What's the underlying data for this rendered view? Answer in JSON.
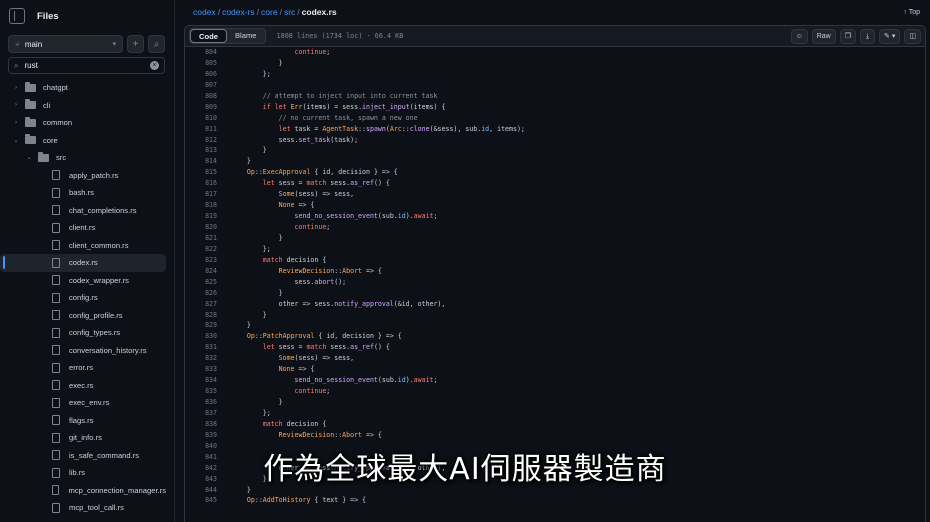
{
  "sidebar": {
    "title": "Files",
    "branch": "main",
    "search_value": "rust",
    "tree": [
      {
        "label": "chatgpt",
        "kind": "folder",
        "depth": 0,
        "open": false
      },
      {
        "label": "cli",
        "kind": "folder",
        "depth": 0,
        "open": false
      },
      {
        "label": "common",
        "kind": "folder",
        "depth": 0,
        "open": false
      },
      {
        "label": "core",
        "kind": "folder",
        "depth": 0,
        "open": true
      },
      {
        "label": "src",
        "kind": "folder",
        "depth": 1,
        "open": true
      },
      {
        "label": "apply_patch.rs",
        "kind": "file",
        "depth": 2
      },
      {
        "label": "bash.rs",
        "kind": "file",
        "depth": 2
      },
      {
        "label": "chat_completions.rs",
        "kind": "file",
        "depth": 2
      },
      {
        "label": "client.rs",
        "kind": "file",
        "depth": 2
      },
      {
        "label": "client_common.rs",
        "kind": "file",
        "depth": 2
      },
      {
        "label": "codex.rs",
        "kind": "file",
        "depth": 2,
        "active": true
      },
      {
        "label": "codex_wrapper.rs",
        "kind": "file",
        "depth": 2
      },
      {
        "label": "config.rs",
        "kind": "file",
        "depth": 2
      },
      {
        "label": "config_profile.rs",
        "kind": "file",
        "depth": 2
      },
      {
        "label": "config_types.rs",
        "kind": "file",
        "depth": 2
      },
      {
        "label": "conversation_history.rs",
        "kind": "file",
        "depth": 2
      },
      {
        "label": "error.rs",
        "kind": "file",
        "depth": 2
      },
      {
        "label": "exec.rs",
        "kind": "file",
        "depth": 2
      },
      {
        "label": "exec_env.rs",
        "kind": "file",
        "depth": 2
      },
      {
        "label": "flags.rs",
        "kind": "file",
        "depth": 2
      },
      {
        "label": "git_info.rs",
        "kind": "file",
        "depth": 2
      },
      {
        "label": "is_safe_command.rs",
        "kind": "file",
        "depth": 2
      },
      {
        "label": "lib.rs",
        "kind": "file",
        "depth": 2
      },
      {
        "label": "mcp_connection_manager.rs",
        "kind": "file",
        "depth": 2
      },
      {
        "label": "mcp_tool_call.rs",
        "kind": "file",
        "depth": 2
      }
    ]
  },
  "breadcrumb": {
    "parts": [
      "codex",
      "codex-rs",
      "core",
      "src"
    ],
    "current": "codex.rs",
    "top_label": "Top"
  },
  "toolbar": {
    "code_label": "Code",
    "blame_label": "Blame",
    "meta": "1808 lines (1734 loc) · 66.4 KB",
    "raw_label": "Raw"
  },
  "code": {
    "lines": [
      {
        "n": "804",
        "html": "                <span class='kw'>continue</span>;"
      },
      {
        "n": "805",
        "html": "            }"
      },
      {
        "n": "806",
        "html": "        };"
      },
      {
        "n": "807",
        "html": ""
      },
      {
        "n": "808",
        "html": "        <span class='cm'>// attempt to inject input into current task</span>"
      },
      {
        "n": "809",
        "html": "        <span class='kw'>if let</span> <span class='ty'>Err</span>(items) = sess.<span class='fn'>inject_input</span>(items) {"
      },
      {
        "n": "810",
        "html": "            <span class='cm'>// no current task, spawn a new one</span>"
      },
      {
        "n": "811",
        "html": "            <span class='kw'>let</span> task = <span class='ty'>AgentTask</span>::<span class='fn'>spawn</span>(<span class='ty'>Arc</span>::<span class='fn'>clone</span>(&amp;sess), sub.<span class='pr'>id</span>, items);"
      },
      {
        "n": "812",
        "html": "            sess.<span class='fn'>set_task</span>(task);"
      },
      {
        "n": "813",
        "html": "        }"
      },
      {
        "n": "814",
        "html": "    }"
      },
      {
        "n": "815",
        "html": "    <span class='ty'>Op</span>::<span class='ty'>ExecApproval</span> { id, decision } =&gt; {"
      },
      {
        "n": "816",
        "html": "        <span class='kw'>let</span> sess = <span class='kw'>match</span> sess.<span class='fn'>as_ref</span>() {"
      },
      {
        "n": "817",
        "html": "            <span class='ty'>Some</span>(sess) =&gt; sess,"
      },
      {
        "n": "818",
        "html": "            <span class='ty'>None</span> =&gt; {"
      },
      {
        "n": "819",
        "html": "                <span class='fn'>send_no_session_event</span>(sub.<span class='pr'>id</span>).<span class='kw'>await</span>;"
      },
      {
        "n": "820",
        "html": "                <span class='kw'>continue</span>;"
      },
      {
        "n": "821",
        "html": "            }"
      },
      {
        "n": "822",
        "html": "        };"
      },
      {
        "n": "823",
        "html": "        <span class='kw'>match</span> decision {"
      },
      {
        "n": "824",
        "html": "            <span class='ty'>ReviewDecision</span>::<span class='ty'>Abort</span> =&gt; {"
      },
      {
        "n": "825",
        "html": "                sess.<span class='fn'>abort</span>();"
      },
      {
        "n": "826",
        "html": "            }"
      },
      {
        "n": "827",
        "html": "            other =&gt; sess.<span class='fn'>notify_approval</span>(&amp;id, other),"
      },
      {
        "n": "828",
        "html": "        }"
      },
      {
        "n": "829",
        "html": "    }"
      },
      {
        "n": "830",
        "html": "    <span class='ty'>Op</span>::<span class='ty'>PatchApproval</span> { id, decision } =&gt; {"
      },
      {
        "n": "831",
        "html": "        <span class='kw'>let</span> sess = <span class='kw'>match</span> sess.<span class='fn'>as_ref</span>() {"
      },
      {
        "n": "832",
        "html": "            <span class='ty'>Some</span>(sess) =&gt; sess,"
      },
      {
        "n": "833",
        "html": "            <span class='ty'>None</span> =&gt; {"
      },
      {
        "n": "834",
        "html": "                <span class='fn'>send_no_session_event</span>(sub.<span class='pr'>id</span>).<span class='kw'>await</span>;"
      },
      {
        "n": "835",
        "html": "                <span class='kw'>continue</span>;"
      },
      {
        "n": "836",
        "html": "            }"
      },
      {
        "n": "837",
        "html": "        };"
      },
      {
        "n": "838",
        "html": "        <span class='kw'>match</span> decision {"
      },
      {
        "n": "839",
        "html": "            <span class='ty'>ReviewDecision</span>::<span class='ty'>Abort</span> =&gt; {"
      },
      {
        "n": "840",
        "html": ""
      },
      {
        "n": "841",
        "html": ""
      },
      {
        "n": "842",
        "html": "            other =&gt; sess.<span class='fn'>notify_approval</span>(&amp;id, other),"
      },
      {
        "n": "843",
        "html": "        }"
      },
      {
        "n": "844",
        "html": "    }"
      },
      {
        "n": "845",
        "html": "    <span class='ty'>Op</span>::<span class='ty'>AddToHistory</span> { text } =&gt; {"
      }
    ]
  },
  "subtitle": "作為全球最大AI伺服器製造商",
  "colors": {
    "background": "#0d1117",
    "link": "#4493f8",
    "keyword": "#ff7b72",
    "function": "#d2a8ff",
    "type": "#ffa657",
    "comment": "#8b949e"
  }
}
